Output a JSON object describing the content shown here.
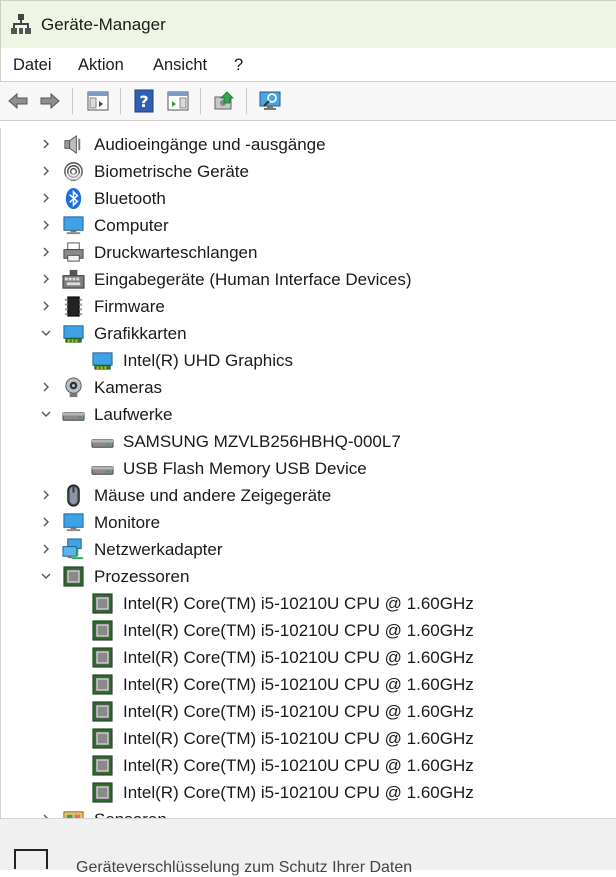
{
  "window": {
    "title": "Geräte-Manager"
  },
  "menu": [
    "Datei",
    "Aktion",
    "Ansicht",
    "?"
  ],
  "toolbar": [
    "back",
    "forward",
    "console-tree",
    "help",
    "action-pane",
    "update-driver",
    "scan-hardware"
  ],
  "tree": [
    {
      "label": "Audioeingänge und -ausgänge",
      "level": 1,
      "state": "collapsed",
      "icon": "speaker-icon"
    },
    {
      "label": "Biometrische Geräte",
      "level": 1,
      "state": "collapsed",
      "icon": "fingerprint-icon"
    },
    {
      "label": "Bluetooth",
      "level": 1,
      "state": "collapsed",
      "icon": "bluetooth-icon"
    },
    {
      "label": "Computer",
      "level": 1,
      "state": "collapsed",
      "icon": "computer-icon"
    },
    {
      "label": "Druckwarteschlangen",
      "level": 1,
      "state": "collapsed",
      "icon": "printer-icon"
    },
    {
      "label": "Eingabegeräte (Human Interface Devices)",
      "level": 1,
      "state": "collapsed",
      "icon": "hid-icon"
    },
    {
      "label": "Firmware",
      "level": 1,
      "state": "collapsed",
      "icon": "firmware-icon"
    },
    {
      "label": "Grafikkarten",
      "level": 1,
      "state": "expanded",
      "icon": "display-adapter-icon"
    },
    {
      "label": "Intel(R) UHD Graphics",
      "level": 2,
      "state": "leaf",
      "icon": "display-adapter-icon"
    },
    {
      "label": "Kameras",
      "level": 1,
      "state": "collapsed",
      "icon": "camera-icon"
    },
    {
      "label": "Laufwerke",
      "level": 1,
      "state": "expanded",
      "icon": "drive-icon"
    },
    {
      "label": "SAMSUNG MZVLB256HBHQ-000L7",
      "level": 2,
      "state": "leaf",
      "icon": "drive-icon"
    },
    {
      "label": "USB Flash Memory USB Device",
      "level": 2,
      "state": "leaf",
      "icon": "drive-icon"
    },
    {
      "label": "Mäuse und andere Zeigegeräte",
      "level": 1,
      "state": "collapsed",
      "icon": "mouse-icon"
    },
    {
      "label": "Monitore",
      "level": 1,
      "state": "collapsed",
      "icon": "monitor-icon"
    },
    {
      "label": "Netzwerkadapter",
      "level": 1,
      "state": "collapsed",
      "icon": "network-icon"
    },
    {
      "label": "Prozessoren",
      "level": 1,
      "state": "expanded",
      "icon": "processor-icon"
    },
    {
      "label": "Intel(R) Core(TM) i5-10210U CPU @ 1.60GHz",
      "level": 2,
      "state": "leaf",
      "icon": "processor-icon"
    },
    {
      "label": "Intel(R) Core(TM) i5-10210U CPU @ 1.60GHz",
      "level": 2,
      "state": "leaf",
      "icon": "processor-icon"
    },
    {
      "label": "Intel(R) Core(TM) i5-10210U CPU @ 1.60GHz",
      "level": 2,
      "state": "leaf",
      "icon": "processor-icon"
    },
    {
      "label": "Intel(R) Core(TM) i5-10210U CPU @ 1.60GHz",
      "level": 2,
      "state": "leaf",
      "icon": "processor-icon"
    },
    {
      "label": "Intel(R) Core(TM) i5-10210U CPU @ 1.60GHz",
      "level": 2,
      "state": "leaf",
      "icon": "processor-icon"
    },
    {
      "label": "Intel(R) Core(TM) i5-10210U CPU @ 1.60GHz",
      "level": 2,
      "state": "leaf",
      "icon": "processor-icon"
    },
    {
      "label": "Intel(R) Core(TM) i5-10210U CPU @ 1.60GHz",
      "level": 2,
      "state": "leaf",
      "icon": "processor-icon"
    },
    {
      "label": "Intel(R) Core(TM) i5-10210U CPU @ 1.60GHz",
      "level": 2,
      "state": "leaf",
      "icon": "processor-icon"
    },
    {
      "label": "Sensoren",
      "level": 1,
      "state": "collapsed",
      "icon": "sensor-icon"
    }
  ],
  "footer": {
    "text": "Geräteverschlüsselung zum Schutz Ihrer Daten"
  },
  "colors": {
    "title_bg": "#eef6e3",
    "toolbar_bg": "#f7f7f7",
    "status_bg": "#f0f0f0"
  }
}
